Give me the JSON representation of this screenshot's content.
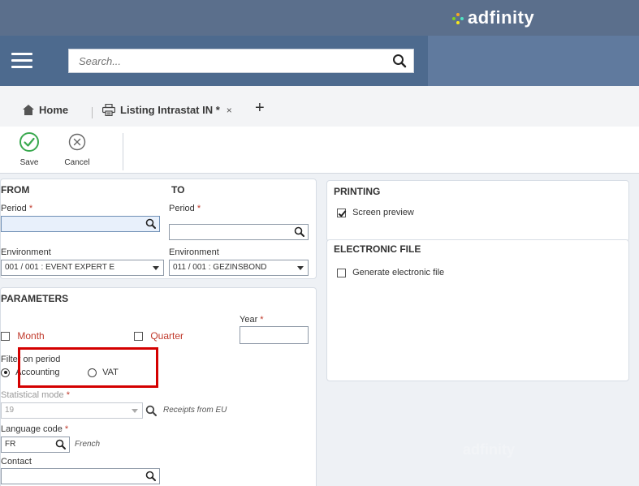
{
  "brand": {
    "name": "adfinity"
  },
  "search": {
    "placeholder": "Search..."
  },
  "tabs": {
    "home": "Home",
    "listing": "Listing Intrastat IN *",
    "close": "×",
    "add": "+"
  },
  "toolbar": {
    "save": "Save",
    "cancel": "Cancel"
  },
  "from_panel": {
    "title": "FROM",
    "period_label": "Period",
    "environment_label": "Environment",
    "environment_value": "001 / 001 : EVENT EXPERT E"
  },
  "to_panel": {
    "title": "TO",
    "period_label": "Period",
    "environment_label": "Environment",
    "environment_value": "011 / 001 : GEZINSBOND"
  },
  "required_mark": "*",
  "parameters": {
    "title": "PARAMETERS",
    "year_label": "Year",
    "month_label": "Month",
    "quarter_label": "Quarter",
    "filter_label": "Filter on period",
    "accounting_label": "Accounting",
    "vat_label": "VAT",
    "statistical_label": "Statistical mode",
    "statistical_value": "19",
    "statistical_hint": "Receipts from EU",
    "language_label": "Language code",
    "language_value": "FR",
    "language_hint": "French",
    "contact_label": "Contact"
  },
  "printing": {
    "title": "PRINTING",
    "screen_preview": "Screen preview"
  },
  "electronic": {
    "title": "ELECTRONIC FILE",
    "generate": "Generate electronic file"
  },
  "watermark": "adfinity",
  "colors": {
    "topbar": "#5b6f8c",
    "searchbar": "#4d6a8e",
    "save_green": "#3aa94f",
    "required_red": "#c0392b",
    "highlight_red": "#d40000"
  }
}
